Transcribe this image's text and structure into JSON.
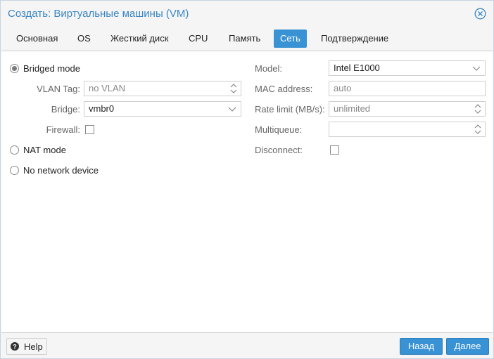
{
  "window": {
    "title": "Создать: Виртуальные машины (VM)",
    "close_icon": "close-circle-icon"
  },
  "tabs": [
    {
      "label": "Основная",
      "active": false
    },
    {
      "label": "OS",
      "active": false
    },
    {
      "label": "Жесткий диск",
      "active": false
    },
    {
      "label": "CPU",
      "active": false
    },
    {
      "label": "Память",
      "active": false
    },
    {
      "label": "Сеть",
      "active": true
    },
    {
      "label": "Подтверждение",
      "active": false
    }
  ],
  "left": {
    "bridged_label": "Bridged mode",
    "vlan_label": "VLAN Tag:",
    "vlan_placeholder": "no VLAN",
    "bridge_label": "Bridge:",
    "bridge_value": "vmbr0",
    "firewall_label": "Firewall:",
    "nat_label": "NAT mode",
    "none_label": "No network device"
  },
  "right": {
    "model_label": "Model:",
    "model_value": "Intel E1000",
    "mac_label": "MAC address:",
    "mac_value": "auto",
    "rate_label": "Rate limit (MB/s):",
    "rate_placeholder": "unlimited",
    "multiqueue_label": "Multiqueue:",
    "multiqueue_value": "",
    "disconnect_label": "Disconnect:"
  },
  "footer": {
    "help_label": "Help",
    "back_label": "Назад",
    "next_label": "Далее"
  },
  "colors": {
    "accent": "#3892d4",
    "title": "#3a86c4"
  }
}
